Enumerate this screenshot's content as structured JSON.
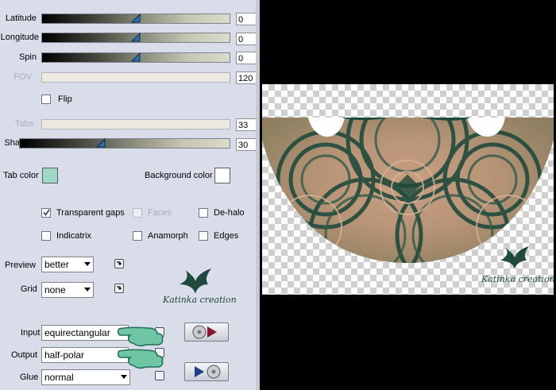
{
  "controls": {
    "latitude": {
      "label": "Latitude",
      "value": "0",
      "level": 0.5
    },
    "longitude": {
      "label": "Longitude",
      "value": "0",
      "level": 0.5
    },
    "spin": {
      "label": "Spin",
      "value": "0",
      "level": 0.5
    },
    "fov": {
      "label": "FOV",
      "value": "120"
    },
    "flip": {
      "label": "Flip",
      "checked": false
    },
    "tabs": {
      "label": "Tabs",
      "value": "33"
    },
    "sharpen": {
      "label": "Sharpen",
      "value": "30",
      "level": 0.3
    }
  },
  "colors": {
    "tab_color_label": "Tab color",
    "tab_color": "#9fd8c4",
    "background_color_label": "Background color",
    "background_color": "#ffffff"
  },
  "options": {
    "transparent_gaps": {
      "label": "Transparent gaps",
      "checked": true
    },
    "faces": {
      "label": "Faces",
      "checked": false
    },
    "de_halo": {
      "label": "De-halo",
      "checked": false
    },
    "indicatrix": {
      "label": "Indicatrix",
      "checked": false
    },
    "anamorph": {
      "label": "Anamorph",
      "checked": false
    },
    "edges": {
      "label": "Edges",
      "checked": false
    }
  },
  "preview_select": {
    "label": "Preview",
    "value": "better"
  },
  "grid_select": {
    "label": "Grid",
    "value": "none"
  },
  "watermark": "Katinka creation",
  "io": {
    "input_label": "Input",
    "input_value": "equirectangular",
    "output_label": "Output",
    "output_value": "half-polar",
    "glue_label": "Glue",
    "glue_value": "normal"
  },
  "image_colors": {
    "dark_green": "#1e4a3c",
    "tan": "#c99e80"
  }
}
